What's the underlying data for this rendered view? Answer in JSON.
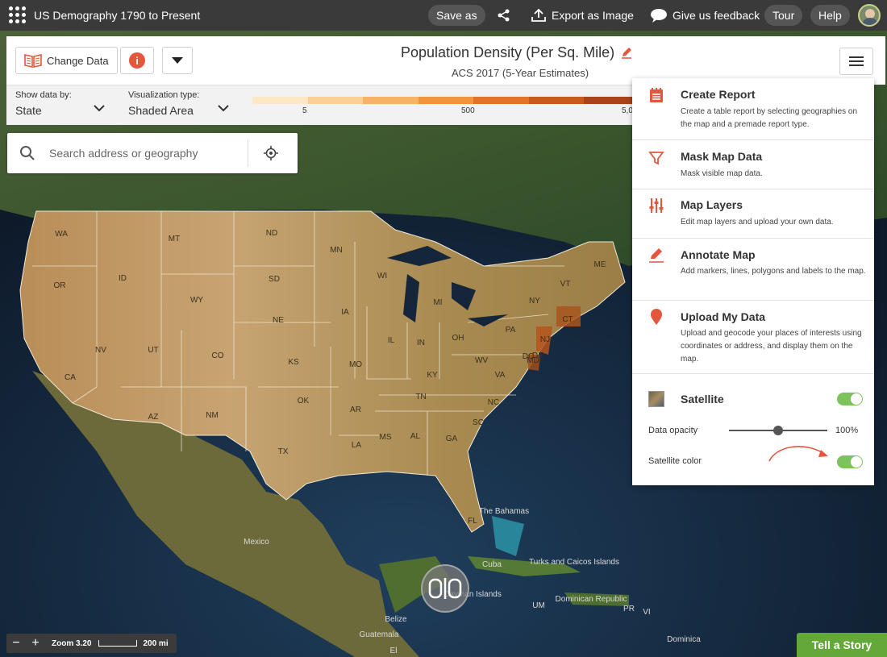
{
  "topbar": {
    "app_title": "US Demography 1790 to Present",
    "save_as": "Save as",
    "export": "Export as Image",
    "feedback": "Give us feedback",
    "tour": "Tour",
    "help": "Help"
  },
  "header": {
    "change_data": "Change Data",
    "info_icon": "i",
    "title": "Population Density (Per Sq. Mile)",
    "subtitle": "ACS 2017 (5-Year Estimates)"
  },
  "settings": {
    "show_data_by_label": "Show data by:",
    "show_data_by_value": "State",
    "viz_type_label": "Visualization type:",
    "viz_type_value": "Shaded Area",
    "legend_colors": [
      "#fde7c4",
      "#fbcf96",
      "#f6b366",
      "#f0953c",
      "#e2742a",
      "#c95a1e",
      "#a8431a"
    ],
    "legend_ticks": [
      "5",
      "500",
      "5,0"
    ]
  },
  "search": {
    "placeholder": "Search address or geography"
  },
  "side_menu": {
    "items": [
      {
        "title": "Create Report",
        "desc": "Create a table report by selecting geographies on the map and a premade report type.",
        "icon": "report-icon"
      },
      {
        "title": "Mask Map Data",
        "desc": "Mask visible map data.",
        "icon": "filter-icon"
      },
      {
        "title": "Map Layers",
        "desc": "Edit map layers and upload your own data.",
        "icon": "layers-sliders-icon"
      },
      {
        "title": "Annotate Map",
        "desc": "Add markers, lines, polygons and labels to the map.",
        "icon": "pencil-icon"
      },
      {
        "title": "Upload My Data",
        "desc": "Upload and geocode your places of interests using coordinates or address, and display them on the map.",
        "icon": "map-pin-icon"
      }
    ],
    "satellite_label": "Satellite",
    "satellite_on": true,
    "opacity_label": "Data opacity",
    "opacity_value": "100%",
    "opacity_fraction": 0.5,
    "satellite_color_label": "Satellite color",
    "satellite_color_on": true,
    "accent_color": "#e2573e",
    "toggle_color": "#7cc35d"
  },
  "map": {
    "states": [
      "WA",
      "MT",
      "ND",
      "MN",
      "ID",
      "OR",
      "SD",
      "WY",
      "WI",
      "MI",
      "IA",
      "NE",
      "NV",
      "UT",
      "CO",
      "IL",
      "IN",
      "OH",
      "PA",
      "NY",
      "VT",
      "ME",
      "CT",
      "NJ",
      "DE",
      "DC",
      "MD",
      "WV",
      "VA",
      "KS",
      "MO",
      "KY",
      "CA",
      "OK",
      "TN",
      "NC",
      "AZ",
      "NM",
      "AR",
      "SC",
      "MS",
      "AL",
      "GA",
      "TX",
      "LA",
      "FL"
    ],
    "places": [
      "Mexico",
      "The Bahamas",
      "Turks and Caicos Islands",
      "Cuba",
      "Cayman Islands",
      "Dominican Republic",
      "UM",
      "PR",
      "VI",
      "Belize",
      "Guatemala",
      "El",
      "Dominica"
    ]
  },
  "bottom": {
    "zoom_label": "Zoom 3.20",
    "scale_label": "200 mi",
    "tell_story": "Tell a Story"
  }
}
